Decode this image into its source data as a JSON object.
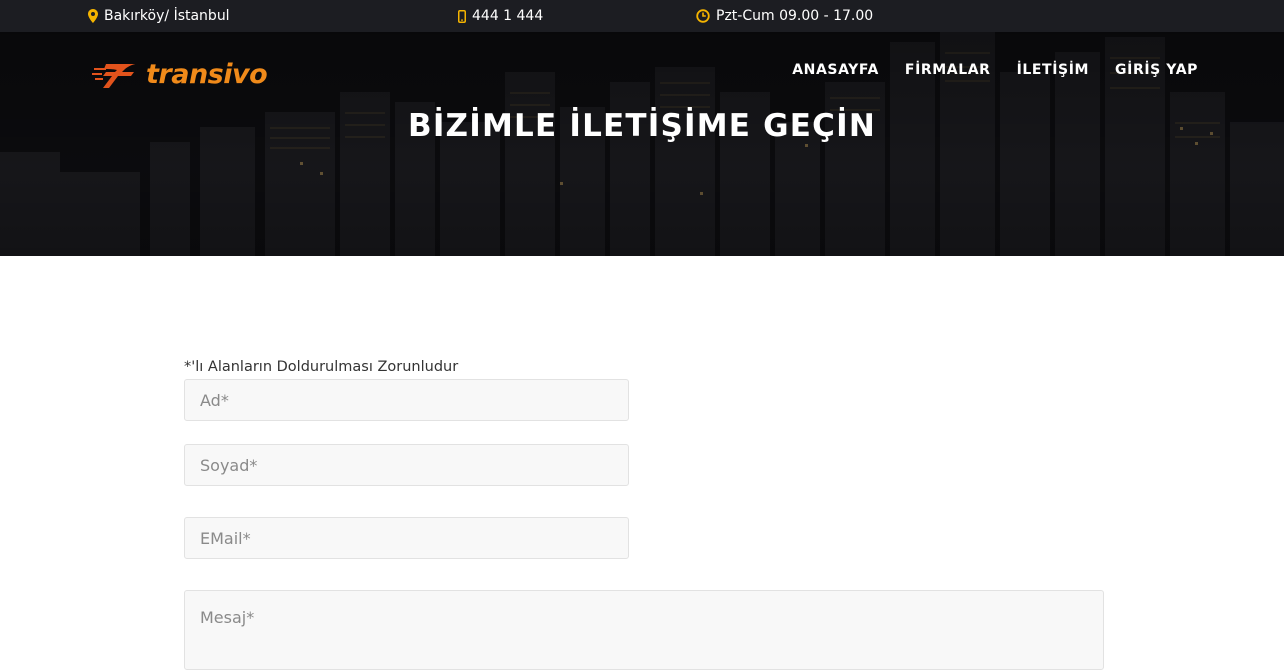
{
  "topbar": {
    "location": "Bakırköy/ İstanbul",
    "phone": "444 1 444",
    "hours": "Pzt-Cum 09.00 - 17.00",
    "location_icon": "map-marker-icon",
    "phone_icon": "mobile-phone-icon",
    "hours_icon": "clock-icon"
  },
  "brand": {
    "name": "transivo",
    "accent_color": "#f08a1a"
  },
  "nav": {
    "items": [
      "ANASAYFA",
      "FİRMALAR",
      "İLETİŞİM",
      "GİRİŞ YAP"
    ]
  },
  "hero": {
    "title": "BİZİMLE İLETİŞİME GEÇİN"
  },
  "form": {
    "required_note": "*'lı Alanların Doldurulması Zorunludur",
    "first_name": {
      "placeholder": "Ad*",
      "value": ""
    },
    "last_name": {
      "placeholder": "Soyad*",
      "value": ""
    },
    "email": {
      "placeholder": "EMail*",
      "value": ""
    },
    "message": {
      "placeholder": "Mesaj*",
      "value": ""
    }
  },
  "colors": {
    "topbar_bg": "#1c1d22",
    "icon_yellow": "#f5b400",
    "field_bg": "#f8f8f8"
  }
}
